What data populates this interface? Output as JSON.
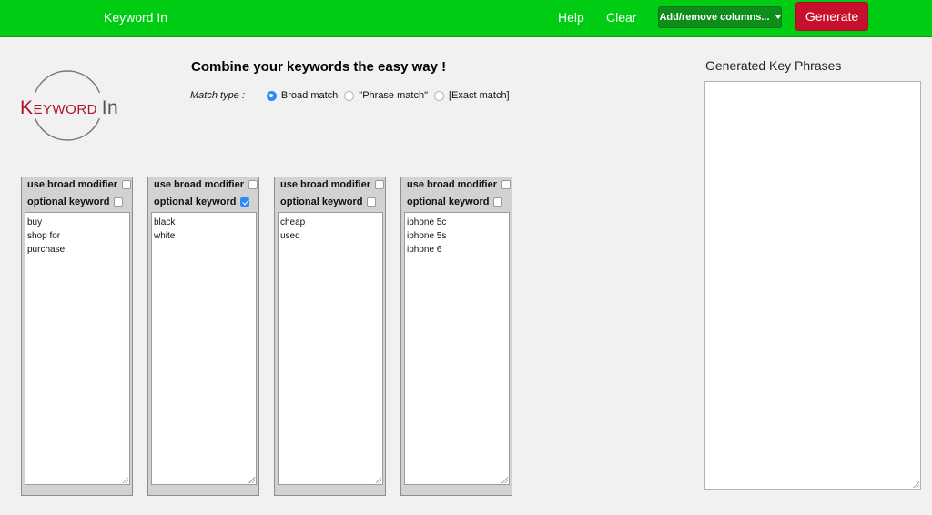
{
  "navbar": {
    "brand": "Keyword In",
    "help": "Help",
    "clear": "Clear",
    "columns_button": "Add/remove columns...",
    "generate": "Generate"
  },
  "logo": {
    "text_prefix": "Keyword",
    "text_suffix": "In"
  },
  "main": {
    "headline": "Combine your keywords the easy way !",
    "match_type_label": "Match type :",
    "match_options": [
      "Broad match",
      "\"Phrase match\"",
      "[Exact match]"
    ],
    "selected_match": 0
  },
  "columns": [
    {
      "broad_modifier_label": "use broad modifier",
      "optional_label": "optional keyword",
      "optional_checked": false,
      "keywords": [
        "buy",
        "shop for",
        "purchase"
      ]
    },
    {
      "broad_modifier_label": "use broad modifier",
      "optional_label": "optional keyword",
      "optional_checked": true,
      "keywords": [
        "black",
        "white"
      ]
    },
    {
      "broad_modifier_label": "use broad modifier",
      "optional_label": "optional keyword",
      "optional_checked": false,
      "keywords": [
        "cheap",
        "used"
      ]
    },
    {
      "broad_modifier_label": "use broad modifier",
      "optional_label": "optional keyword",
      "optional_checked": false,
      "keywords": [
        "iphone 5c",
        "iphone 5s",
        "iphone 6"
      ]
    }
  ],
  "output": {
    "title": "Generated Key Phrases"
  },
  "colors": {
    "nav": "#00cc14",
    "generate": "#c8102e",
    "columns_button": "#0d8d1a",
    "radio_selected": "#2e8bf5"
  }
}
